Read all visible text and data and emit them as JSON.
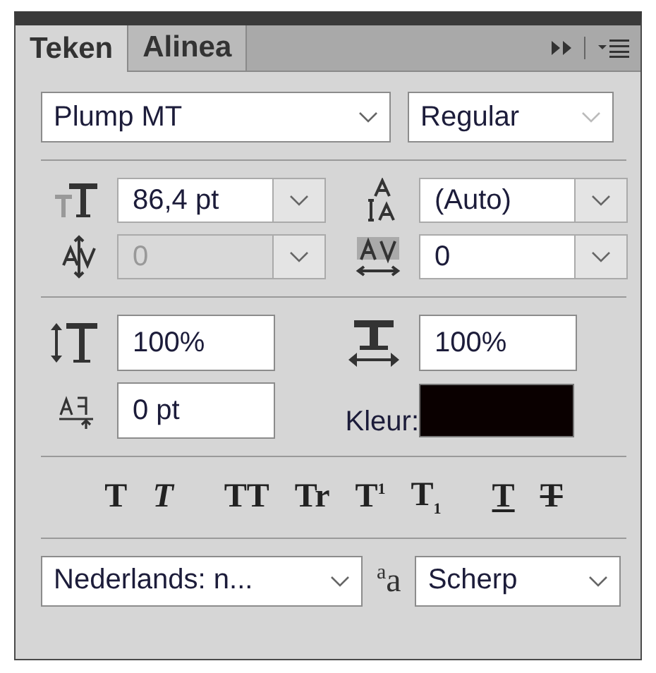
{
  "tabs": [
    {
      "label": "Teken",
      "selected": true
    },
    {
      "label": "Alinea",
      "selected": false
    }
  ],
  "font": {
    "family": "Plump MT",
    "style": "Regular"
  },
  "fields": [
    {
      "kind": "size",
      "value": "86,4 pt",
      "disabled": false,
      "dropdown": true
    },
    {
      "kind": "leading",
      "value": "(Auto)",
      "disabled": false,
      "dropdown": true
    },
    {
      "kind": "kerning",
      "value": "0",
      "disabled": true,
      "dropdown": true
    },
    {
      "kind": "tracking",
      "value": "0",
      "disabled": false,
      "dropdown": true
    },
    {
      "kind": "vscale",
      "value": "100%",
      "disabled": false,
      "dropdown": false
    },
    {
      "kind": "hscale",
      "value": "100%",
      "disabled": false,
      "dropdown": false
    },
    {
      "kind": "baseline",
      "value": "0 pt",
      "disabled": false,
      "dropdown": false
    }
  ],
  "color": {
    "label": "Kleur:",
    "color": "#0a0000"
  },
  "styles": [
    {
      "kind": "bold",
      "label": "T"
    },
    {
      "kind": "italic",
      "label": "T"
    },
    {
      "kind": "allcaps",
      "label": "TT"
    },
    {
      "kind": "smallcaps",
      "label": "Tr"
    },
    {
      "kind": "super",
      "label": "T$^{1}$"
    },
    {
      "kind": "sub",
      "label": "T$_{1}$"
    },
    {
      "kind": "underline",
      "label": "T"
    },
    {
      "kind": "strike",
      "label": "T"
    }
  ],
  "language": "Nederlands: n...",
  "antialias": {
    "icon": "$^{a}$a",
    "value": "Scherp"
  }
}
